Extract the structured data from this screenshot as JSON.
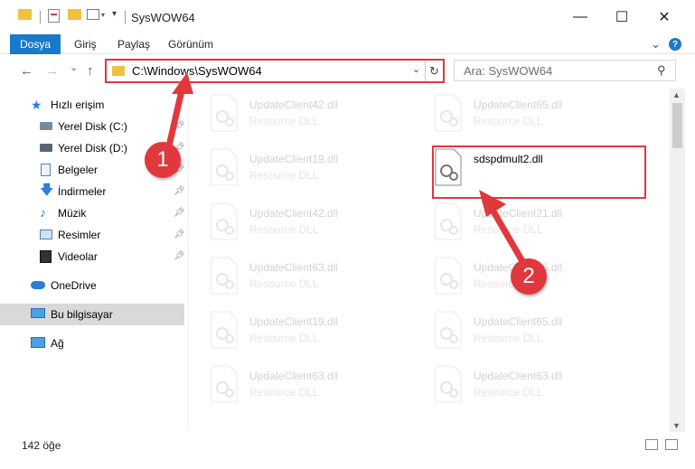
{
  "window": {
    "title": "SysWOW64",
    "minimize_glyph": "—",
    "maximize_glyph": "☐",
    "close_glyph": "✕"
  },
  "ribbon": {
    "file_tab": "Dosya",
    "tabs": [
      "Giriş",
      "Paylaş",
      "Görünüm"
    ],
    "help_glyph": "?",
    "expand_glyph": "⌄"
  },
  "nav": {
    "back_glyph": "←",
    "forward_glyph": "→",
    "recent_glyph": "⌄",
    "up_glyph": "↑",
    "address_path": "C:\\Windows\\SysWOW64",
    "dropdown_glyph": "⌄",
    "refresh_glyph": "↻",
    "search_placeholder": "Ara: SysWOW64",
    "search_glyph": "⚲"
  },
  "sidebar": {
    "items": [
      {
        "label": "Hızlı erişim",
        "icon": "star-icon",
        "pinned": false
      },
      {
        "label": "Yerel Disk (C:)",
        "icon": "drive-icon",
        "pinned": true
      },
      {
        "label": "Yerel Disk (D:)",
        "icon": "drive-icon",
        "pinned": true
      },
      {
        "label": "Belgeler",
        "icon": "documents-icon",
        "pinned": true
      },
      {
        "label": "İndirmeler",
        "icon": "download-icon",
        "pinned": true
      },
      {
        "label": "Müzik",
        "icon": "music-icon",
        "pinned": true
      },
      {
        "label": "Resimler",
        "icon": "pictures-icon",
        "pinned": true
      },
      {
        "label": "Videolar",
        "icon": "video-icon",
        "pinned": true
      },
      {
        "label": "OneDrive",
        "icon": "cloud-icon",
        "pinned": false
      },
      {
        "label": "Bu bilgisayar",
        "icon": "computer-icon",
        "pinned": false
      },
      {
        "label": "Ağ",
        "icon": "network-icon",
        "pinned": false
      }
    ]
  },
  "files": {
    "left": [
      {
        "name": "UpdateClient42.dll",
        "type": "Resource DLL"
      },
      {
        "name": "UpdateClient19.dll",
        "type": "Resource DLL"
      },
      {
        "name": "UpdateClient42.dll",
        "type": "Resource DLL"
      },
      {
        "name": "UpdateClient63.dll",
        "type": "Resource DLL"
      },
      {
        "name": "UpdateClient19.dll",
        "type": "Resource DLL"
      },
      {
        "name": "UpdateClient63.dll",
        "type": "Resource DLL"
      }
    ],
    "right": [
      {
        "name": "UpdateClient65.dll",
        "type": "Resource DLL"
      },
      {
        "name": "sdspdmult2.dll",
        "type": ""
      },
      {
        "name": "UpdateClient21.dll",
        "type": "Resource DLL"
      },
      {
        "name": "UpdateClient65.dll",
        "type": "Resource DLL"
      },
      {
        "name": "UpdateClient65.dll",
        "type": "Resource DLL"
      },
      {
        "name": "UpdateClient63.dll",
        "type": "Resource DLL"
      }
    ]
  },
  "status": {
    "item_count": "142 öğe"
  },
  "annotations": {
    "step1": "1",
    "step2": "2"
  },
  "colors": {
    "accent": "#1979ca",
    "highlight_red": "#e0383c"
  }
}
